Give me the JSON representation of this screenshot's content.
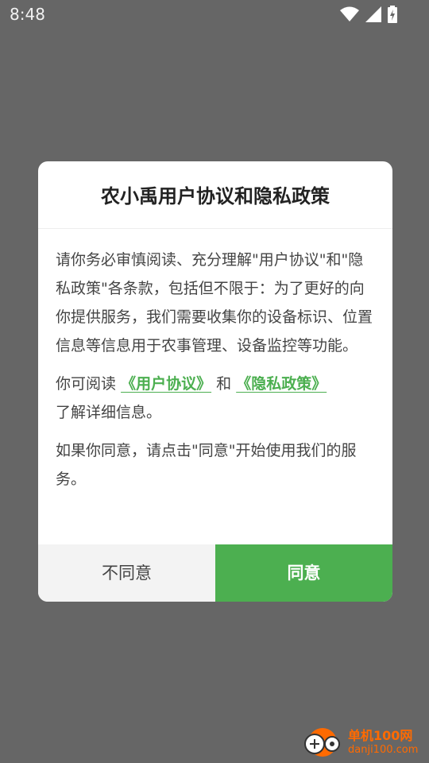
{
  "status_bar": {
    "time": "8:48",
    "icons": [
      "wifi-icon",
      "signal-icon",
      "battery-icon"
    ]
  },
  "dialog": {
    "title": "农小禹用户协议和隐私政策",
    "para1": "请你务必审慎阅读、充分理解\"用户协议\"和\"隐私政策\"各条款，包括但不限于：为了更好的向你提供服务，我们需要收集你的设备标识、位置信息等信息用于农事管理、设备监控等功能。",
    "para2_prefix": "你可阅读",
    "user_agreement_link": "《用户协议》",
    "para2_and": "和",
    "privacy_policy_link": "《隐私政策》",
    "para2_suffix": "了解详细信息。",
    "para3": "如果你同意，请点击\"同意\"开始使用我们的服务。",
    "disagree_label": "不同意",
    "agree_label": "同意"
  },
  "watermark": {
    "line1": "单机100网",
    "line2": "danji100.com"
  },
  "colors": {
    "accent": "#4caf50",
    "overlay": "#666666",
    "watermark": "#ff6a00"
  }
}
